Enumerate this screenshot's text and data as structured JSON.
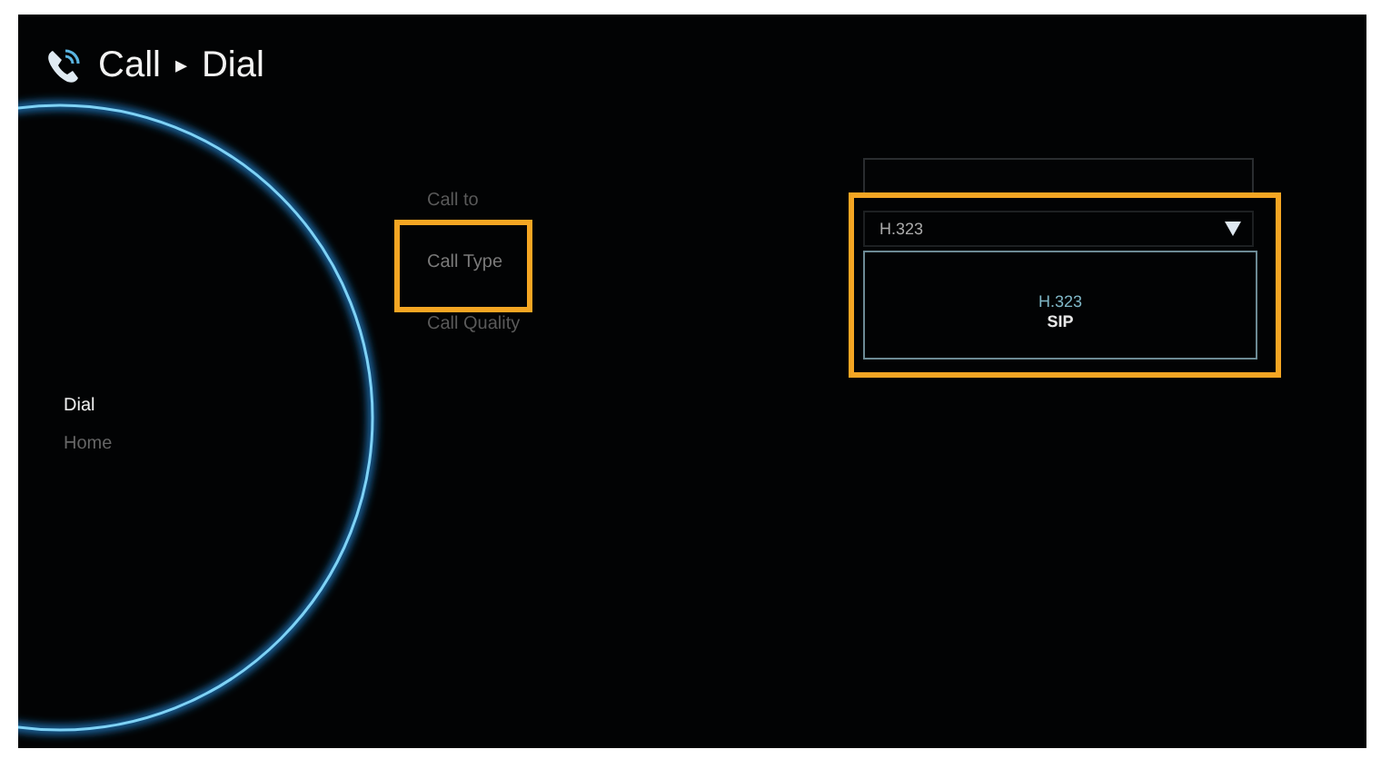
{
  "header": {
    "section": "Call",
    "separator": "▸",
    "page": "Dial"
  },
  "sidebar": {
    "items": [
      {
        "label": "Dial",
        "selected": true
      },
      {
        "label": "Home",
        "selected": false
      }
    ]
  },
  "form": {
    "rows": [
      {
        "label": "Call to",
        "kind": "text",
        "value": "",
        "highlighted": false
      },
      {
        "label": "Call Type",
        "kind": "dropdown",
        "value": "H.323",
        "expanded": true,
        "highlighted": true,
        "options": [
          {
            "label": "H.323",
            "selected": true
          },
          {
            "label": "SIP",
            "selected": false
          }
        ]
      },
      {
        "label": "Call Quality",
        "kind": "none",
        "highlighted": false
      }
    ]
  }
}
